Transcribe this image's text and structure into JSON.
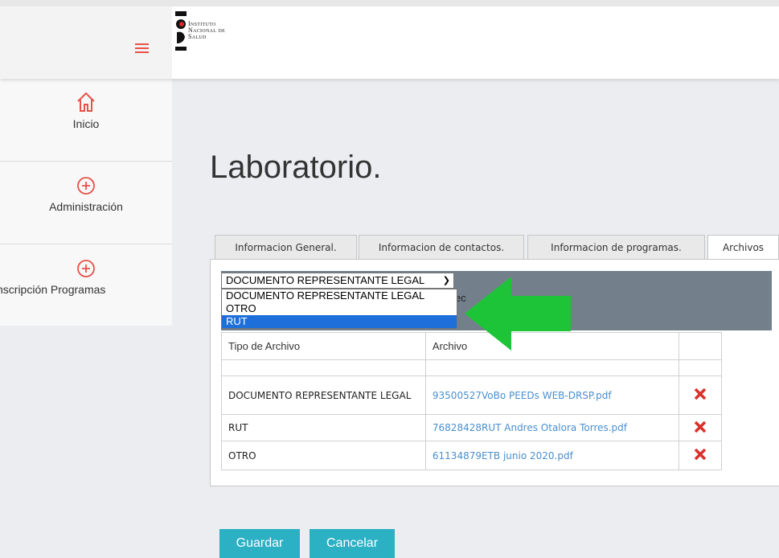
{
  "logo": {
    "lines": [
      "Instituto",
      "Nacional de",
      "Salud"
    ]
  },
  "sidebar": {
    "items": [
      {
        "label": "Inicio",
        "icon": "home-icon"
      },
      {
        "label": "Administración",
        "icon": "plus-circle-icon"
      },
      {
        "label": "nscripción Programas",
        "icon": "plus-circle-icon"
      }
    ]
  },
  "page": {
    "title": "Laboratorio."
  },
  "tabs": [
    {
      "label": "Informacion General."
    },
    {
      "label": "Informacion de contactos."
    },
    {
      "label": "Informacion de programas."
    },
    {
      "label": "Archivos",
      "active": true
    }
  ],
  "file_type_select": {
    "value": "DOCUMENTO REPRESENTANTE LEGAL",
    "options": [
      "DOCUMENTO REPRESENTANTE LEGAL",
      "OTRO",
      "RUT"
    ],
    "highlighted": "RUT",
    "behind_text": "ec"
  },
  "table": {
    "headers": [
      "Tipo de Archivo",
      "Archivo",
      ""
    ],
    "rows": [
      {
        "tipo": "DOCUMENTO REPRESENTANTE LEGAL",
        "archivo": "93500527VoBo PEEDs WEB-DRSP.pdf"
      },
      {
        "tipo": "RUT",
        "archivo": "76828428RUT Andres Otalora Torres.pdf"
      },
      {
        "tipo": "OTRO",
        "archivo": "61134879ETB junio 2020.pdf"
      }
    ]
  },
  "actions": {
    "save": "Guardar",
    "cancel": "Cancelar"
  },
  "colors": {
    "accent": "#2bb0c4",
    "delete": "#d9312b",
    "arrow": "#1ec438",
    "link": "#4a8fcf"
  }
}
